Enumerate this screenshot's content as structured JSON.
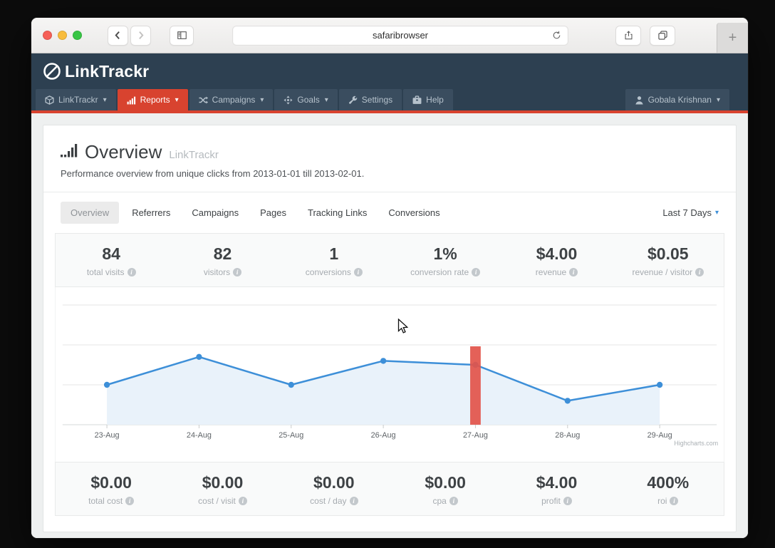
{
  "browser": {
    "url_text": "safaribrowser",
    "new_tab_label": "+"
  },
  "app": {
    "brand": "LinkTrackr",
    "nav": [
      {
        "label": "LinkTrackr",
        "icon": "cube-icon",
        "caret": "▾"
      },
      {
        "label": "Reports",
        "icon": "bar-chart-icon",
        "caret": "▾",
        "active": true
      },
      {
        "label": "Campaigns",
        "icon": "shuffle-icon",
        "caret": "▾"
      },
      {
        "label": "Goals",
        "icon": "goals-icon",
        "caret": "▾"
      },
      {
        "label": "Settings",
        "icon": "wrench-icon"
      },
      {
        "label": "Help",
        "icon": "briefcase-icon"
      }
    ],
    "user": {
      "name": "Gobala Krishnan",
      "caret": "▾"
    }
  },
  "page": {
    "title": "Overview",
    "title_suffix": "LinkTrackr",
    "subtitle": "Performance overview from unique clicks from 2013-01-01 till 2013-02-01.",
    "tabs": [
      {
        "label": "Overview",
        "active": true
      },
      {
        "label": "Referrers"
      },
      {
        "label": "Campaigns"
      },
      {
        "label": "Pages"
      },
      {
        "label": "Tracking Links"
      },
      {
        "label": "Conversions"
      }
    ],
    "range_selector": "Last 7 Days",
    "range_caret": "▾"
  },
  "stats_top": [
    {
      "value": "84",
      "label": "total visits"
    },
    {
      "value": "82",
      "label": "visitors"
    },
    {
      "value": "1",
      "label": "conversions"
    },
    {
      "value": "1%",
      "label": "conversion rate"
    },
    {
      "value": "$4.00",
      "label": "revenue"
    },
    {
      "value": "$0.05",
      "label": "revenue / visitor"
    }
  ],
  "stats_bottom": [
    {
      "value": "$0.00",
      "label": "total cost"
    },
    {
      "value": "$0.00",
      "label": "cost / visit"
    },
    {
      "value": "$0.00",
      "label": "cost / day"
    },
    {
      "value": "$0.00",
      "label": "cpa"
    },
    {
      "value": "$4.00",
      "label": "profit"
    },
    {
      "value": "400%",
      "label": "roi"
    }
  ],
  "chart_data": {
    "type": "line",
    "categories": [
      "23-Aug",
      "24-Aug",
      "25-Aug",
      "26-Aug",
      "27-Aug",
      "28-Aug",
      "29-Aug"
    ],
    "series": [
      {
        "name": "visits",
        "type": "area-line",
        "color": "#3d8fd8",
        "fill": "#e9f2fa",
        "values": [
          10,
          17,
          10,
          16,
          15,
          6,
          10
        ]
      },
      {
        "name": "conversions",
        "type": "column",
        "color": "#e2544a",
        "values": [
          0,
          0,
          0,
          0,
          1,
          0,
          0
        ]
      }
    ],
    "ylim": [
      0,
      30
    ],
    "grid": true,
    "legend": "none",
    "credits": "Highcharts.com"
  },
  "colors": {
    "accent_red": "#d8432f",
    "link_blue": "#3d8fd8",
    "navy": "#2d4051"
  }
}
